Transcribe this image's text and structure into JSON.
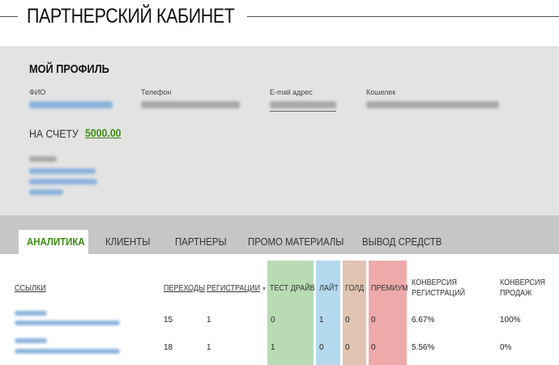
{
  "header": {
    "title": "ПАРТНЕРСКИЙ КАБИНЕТ"
  },
  "profile": {
    "heading": "МОЙ ПРОФИЛЬ",
    "labels": {
      "name": "ФИО",
      "phone": "Телефон",
      "email": "E-mail адрес",
      "wallet": "Кошелек"
    },
    "balance_label": "НА СЧЕТУ",
    "balance_value": "5000.00"
  },
  "tabs": [
    {
      "label": "АНАЛИТИКА",
      "active": true
    },
    {
      "label": "КЛИЕНТЫ"
    },
    {
      "label": "ПАРТНЕРЫ"
    },
    {
      "label": "ПРОМО МАТЕРИАЛЫ"
    },
    {
      "label": "ВЫВОД СРЕДСТВ"
    }
  ],
  "table": {
    "headers": {
      "links": "ССЫЛКИ",
      "clicks": "ПЕРЕХОДЫ",
      "registrations": "РЕГИСТРАЦИИ",
      "test_drive": "ТЕСТ ДРАЙВ",
      "lite": "ЛАЙТ",
      "gold": "ГОЛД",
      "premium": "ПРЕМИУМ",
      "conv_reg_1": "КОНВЕРСИЯ",
      "conv_reg_2": "РЕГИСТРАЦИЙ",
      "conv_sales_1": "КОНВЕРСИЯ",
      "conv_sales_2": "ПРОДАЖ"
    },
    "rows": [
      {
        "clicks": "15",
        "registrations": "1",
        "test_drive": "0",
        "lite": "1",
        "gold": "0",
        "premium": "0",
        "conv_reg": "6.67%",
        "conv_sales": "100%"
      },
      {
        "clicks": "18",
        "registrations": "1",
        "test_drive": "1",
        "lite": "0",
        "gold": "0",
        "premium": "0",
        "conv_reg": "5.56%",
        "conv_sales": "0%"
      }
    ],
    "colors": {
      "test_drive": "#b9dbb4",
      "lite": "#b5d9ef",
      "gold": "#e1c4b2",
      "premium": "#eeaaaa"
    }
  },
  "colors": {
    "accent": "#3d8c14",
    "profile_bg": "#e3e3e3",
    "tabbar_bg": "#c6c6c6"
  }
}
